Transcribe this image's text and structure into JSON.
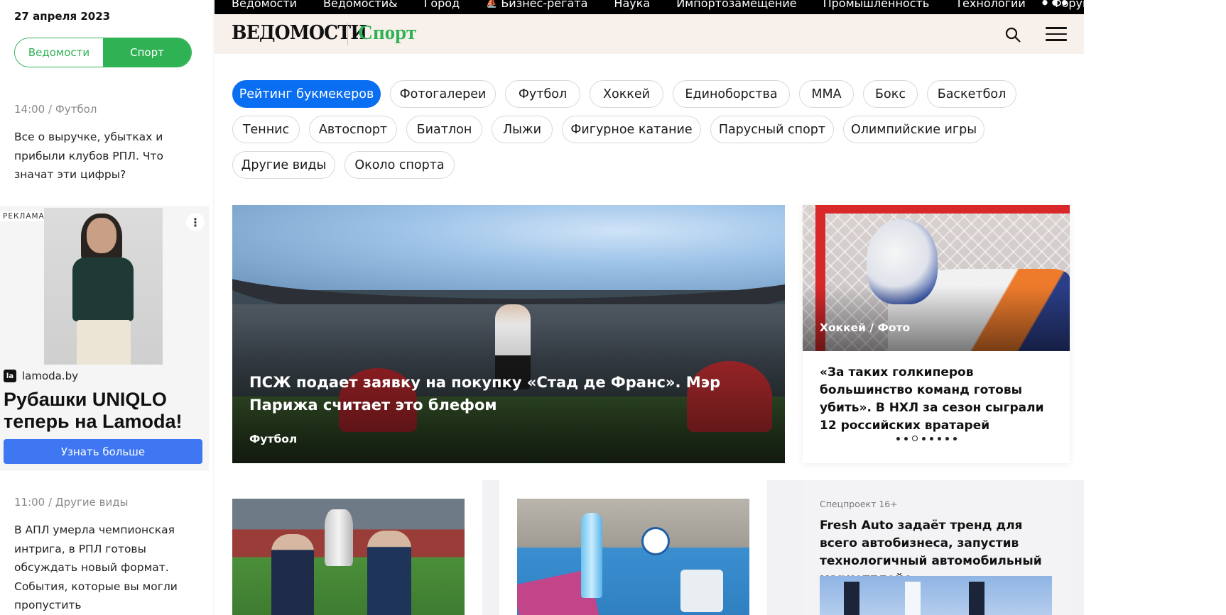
{
  "left": {
    "date": "27 апреля 2023",
    "switch": {
      "off": "Ведомости",
      "on": "Спорт"
    },
    "feed": [
      {
        "time": "14:00",
        "rubric": "Футбол",
        "text": "Все о выручке, убытках и прибыли клубов РПЛ. Что значат эти цифры?"
      },
      {
        "time": "11:00",
        "rubric": "Другие виды",
        "text": "В АПЛ умерла чемпионская интрига, в РПЛ готовы обсуждать новый формат. События, которые вы могли пропустить"
      }
    ],
    "sep": "/",
    "ad": {
      "label": "РЕКЛАМА",
      "more": "⋮",
      "logo": "la",
      "brand": "lamoda.by",
      "title": "Рубашки UNIQLO теперь на Lamoda!",
      "button": "Узнать больше"
    }
  },
  "topnav": {
    "items": [
      "Ведомости",
      "Ведомости&",
      "Город",
      "Бизнес-регата",
      "Наука",
      "Импортозамещение",
      "Промышленность",
      "Технологии",
      "Форум"
    ],
    "more": "•••"
  },
  "header": {
    "logo": "ВЕДОМОСТИ",
    "section": "Спорт"
  },
  "tags": [
    "Рейтинг букмекеров",
    "Фотогалереи",
    "Футбол",
    "Хоккей",
    "Единоборства",
    "ММА",
    "Бокс",
    "Баскетбол",
    "Теннис",
    "Автоспорт",
    "Биатлон",
    "Лыжи",
    "Фигурное катание",
    "Парусный спорт",
    "Олимпийские игры",
    "Другие виды",
    "Около спорта"
  ],
  "hero": {
    "title": "ПСЖ подает заявку на покупку «Стад де Франс». Мэр Парижа считает это блефом",
    "category": "Футбол"
  },
  "slider": {
    "category": "Хоккей / Фото",
    "title": "«За таких голкиперов большинство команд готовы убить». В НХЛ за сезон сыграли 12 российских вратарей",
    "dots": 8,
    "current": 3
  },
  "special": {
    "label": "Спецпроект 16+",
    "title": "Fresh Auto задаёт тренд для всего автобизнеса, запустив технологичный автомобильный маркетплейс"
  },
  "colors": {
    "accent": "#2fb254",
    "active_tag": "#0a6ef2",
    "ad_button": "#3e77f1"
  }
}
